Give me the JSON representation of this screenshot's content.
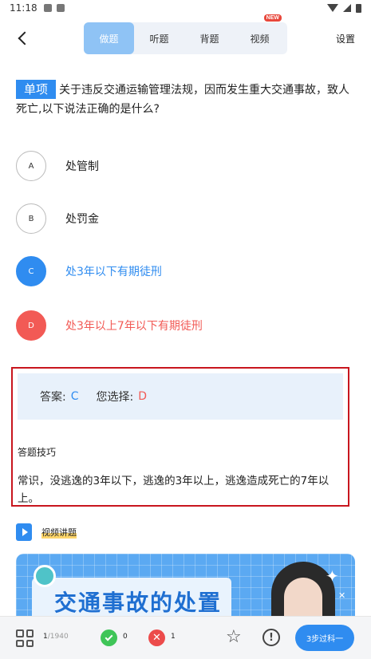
{
  "status_bar": {
    "time": "11:18"
  },
  "header": {
    "tabs": [
      {
        "label": "做题",
        "active": true
      },
      {
        "label": "听题",
        "active": false
      },
      {
        "label": "背题",
        "active": false
      },
      {
        "label": "视频",
        "active": false,
        "badge": "NEW"
      }
    ],
    "settings_label": "设置"
  },
  "question": {
    "type_tag": "单项",
    "text": "关于违反交通运输管理法规，因而发生重大交通事故，致人死亡,以下说法正确的是什么?"
  },
  "options": [
    {
      "letter": "A",
      "text": "处管制",
      "state": "normal"
    },
    {
      "letter": "B",
      "text": "处罚金",
      "state": "normal"
    },
    {
      "letter": "C",
      "text": "处3年以下有期徒刑",
      "state": "correct"
    },
    {
      "letter": "D",
      "text": "处3年以上7年以下有期徒刑",
      "state": "wrong"
    }
  ],
  "answer": {
    "answer_label": "答案:",
    "answer_value": "C",
    "selected_label": "您选择:",
    "selected_value": "D",
    "tips_title": "答题技巧",
    "tips_text": "常识，没逃逸的3年以下，逃逸的3年以上，逃逸造成死亡的7年以上。"
  },
  "video": {
    "label": "视频讲题",
    "title": "交通事故的处置"
  },
  "bottom_bar": {
    "progress_current": "1",
    "progress_total": "/1940",
    "correct_count": "0",
    "wrong_count": "1",
    "cta_label": "3步过科一"
  },
  "colors": {
    "accent": "#2f8cf0",
    "wrong": "#f25a55",
    "correct_green": "#3fc558",
    "highlight_border": "#c8161e"
  }
}
